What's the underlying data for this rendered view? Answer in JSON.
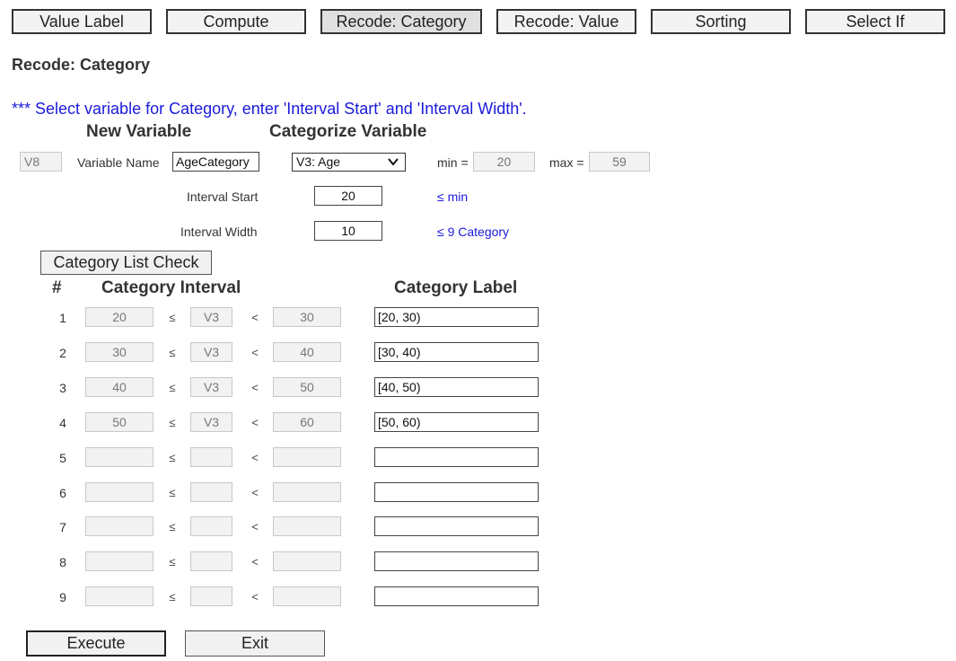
{
  "tabs": [
    "Value Label",
    "Compute",
    "Recode: Category",
    "Recode: Value",
    "Sorting",
    "Select If"
  ],
  "active_tab": "Recode: Category",
  "page_title": "Recode: Category",
  "instruction": "*** Select variable for Category, enter 'Interval Start' and 'Interval Width'.",
  "new_variable": {
    "header": "New Variable",
    "id": "V8",
    "name_label": "Variable Name",
    "name_value": "AgeCategory"
  },
  "categorize": {
    "header": "Categorize Variable",
    "selected": "V3: Age",
    "min_label": "min =",
    "min_value": "20",
    "max_label": "max =",
    "max_value": "59",
    "interval_start_label": "Interval Start",
    "interval_start_value": "20",
    "interval_start_hint": "≤ min",
    "interval_width_label": "Interval Width",
    "interval_width_value": "10",
    "interval_width_hint": "≤ 9 Category"
  },
  "category_check_button": "Category List Check",
  "table": {
    "col_num": "#",
    "col_interval": "Category Interval",
    "col_label": "Category Label",
    "le_symbol": "≤",
    "lt_symbol": "<",
    "rows": [
      {
        "num": "1",
        "start": "20",
        "var": "V3",
        "end": "30",
        "label": "[20, 30)"
      },
      {
        "num": "2",
        "start": "30",
        "var": "V3",
        "end": "40",
        "label": "[30, 40)"
      },
      {
        "num": "3",
        "start": "40",
        "var": "V3",
        "end": "50",
        "label": "[40, 50)"
      },
      {
        "num": "4",
        "start": "50",
        "var": "V3",
        "end": "60",
        "label": "[50, 60)"
      },
      {
        "num": "5",
        "start": "",
        "var": "",
        "end": "",
        "label": ""
      },
      {
        "num": "6",
        "start": "",
        "var": "",
        "end": "",
        "label": ""
      },
      {
        "num": "7",
        "start": "",
        "var": "",
        "end": "",
        "label": ""
      },
      {
        "num": "8",
        "start": "",
        "var": "",
        "end": "",
        "label": ""
      },
      {
        "num": "9",
        "start": "",
        "var": "",
        "end": "",
        "label": ""
      }
    ]
  },
  "execute_button": "Execute",
  "exit_button": "Exit"
}
